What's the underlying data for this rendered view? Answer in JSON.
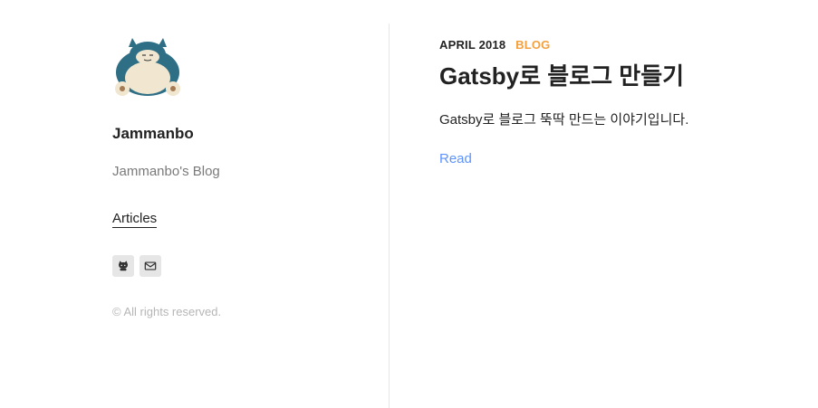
{
  "sidebar": {
    "author_name": "Jammanbo",
    "author_subtitle": "Jammanbo's Blog",
    "menu": [
      {
        "label": "Articles"
      }
    ],
    "contacts": [
      {
        "icon": "github-icon"
      },
      {
        "icon": "email-icon"
      }
    ],
    "copyright": "© All rights reserved."
  },
  "post": {
    "date": "APRIL 2018",
    "category": "BLOG",
    "title": "Gatsby로 블로그 만들기",
    "description": "Gatsby로 블로그 뚝딱 만드는 이야기입니다.",
    "read_label": "Read"
  },
  "colors": {
    "category": "#f4a03c",
    "link": "#5d93ff",
    "muted": "#7a7a7a",
    "copyright": "#b6b6b6",
    "divider": "#e6e6e6"
  }
}
